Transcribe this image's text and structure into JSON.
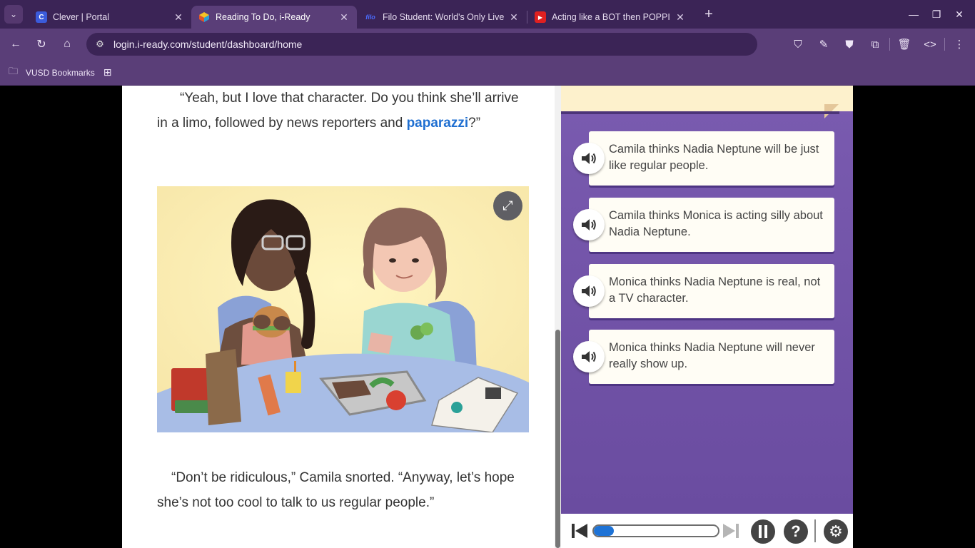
{
  "browser": {
    "tabs": [
      {
        "title": "Clever | Portal",
        "favicon": "C",
        "favicon_color": "#3b5bdb",
        "active": false
      },
      {
        "title": "Reading To Do, i-Ready",
        "favicon": "",
        "favicon_color": "#f08a24",
        "active": true
      },
      {
        "title": "Filo Student: World's Only Live I",
        "favicon": "filo",
        "favicon_color": "#2a3bd6",
        "active": false
      },
      {
        "title": "Acting like a BOT then POPPIN",
        "favicon": "▶",
        "favicon_color": "#e02020",
        "active": false
      }
    ],
    "url": "login.i-ready.com/student/dashboard/home",
    "bookmarks": [
      {
        "label": "VUSD Bookmarks"
      }
    ]
  },
  "passage": {
    "para1_before": "“Yeah, but I love that character. Do you think she’ll arrive in a limo, followed by news reporters and ",
    "para1_vocab": "paparazzi",
    "para1_after": "?”",
    "para2": "“Don’t be ridiculous,” Camila snorted. “Anyway, let’s hope she’s not too cool to talk to us regular people.”"
  },
  "question": {
    "options": [
      {
        "text": "Camila thinks Nadia Neptune will be just like regular people."
      },
      {
        "text": "Camila thinks Monica is acting silly about Nadia Neptune."
      },
      {
        "text": "Monica thinks Nadia Neptune is real, not a TV character."
      },
      {
        "text": "Monica thinks Nadia Neptune will never really show up."
      }
    ]
  },
  "player": {
    "progress": 0.16
  },
  "colors": {
    "panel": "#7a5bb0",
    "vocab": "#1f6fd1",
    "progress_fill": "#1e73d6"
  }
}
